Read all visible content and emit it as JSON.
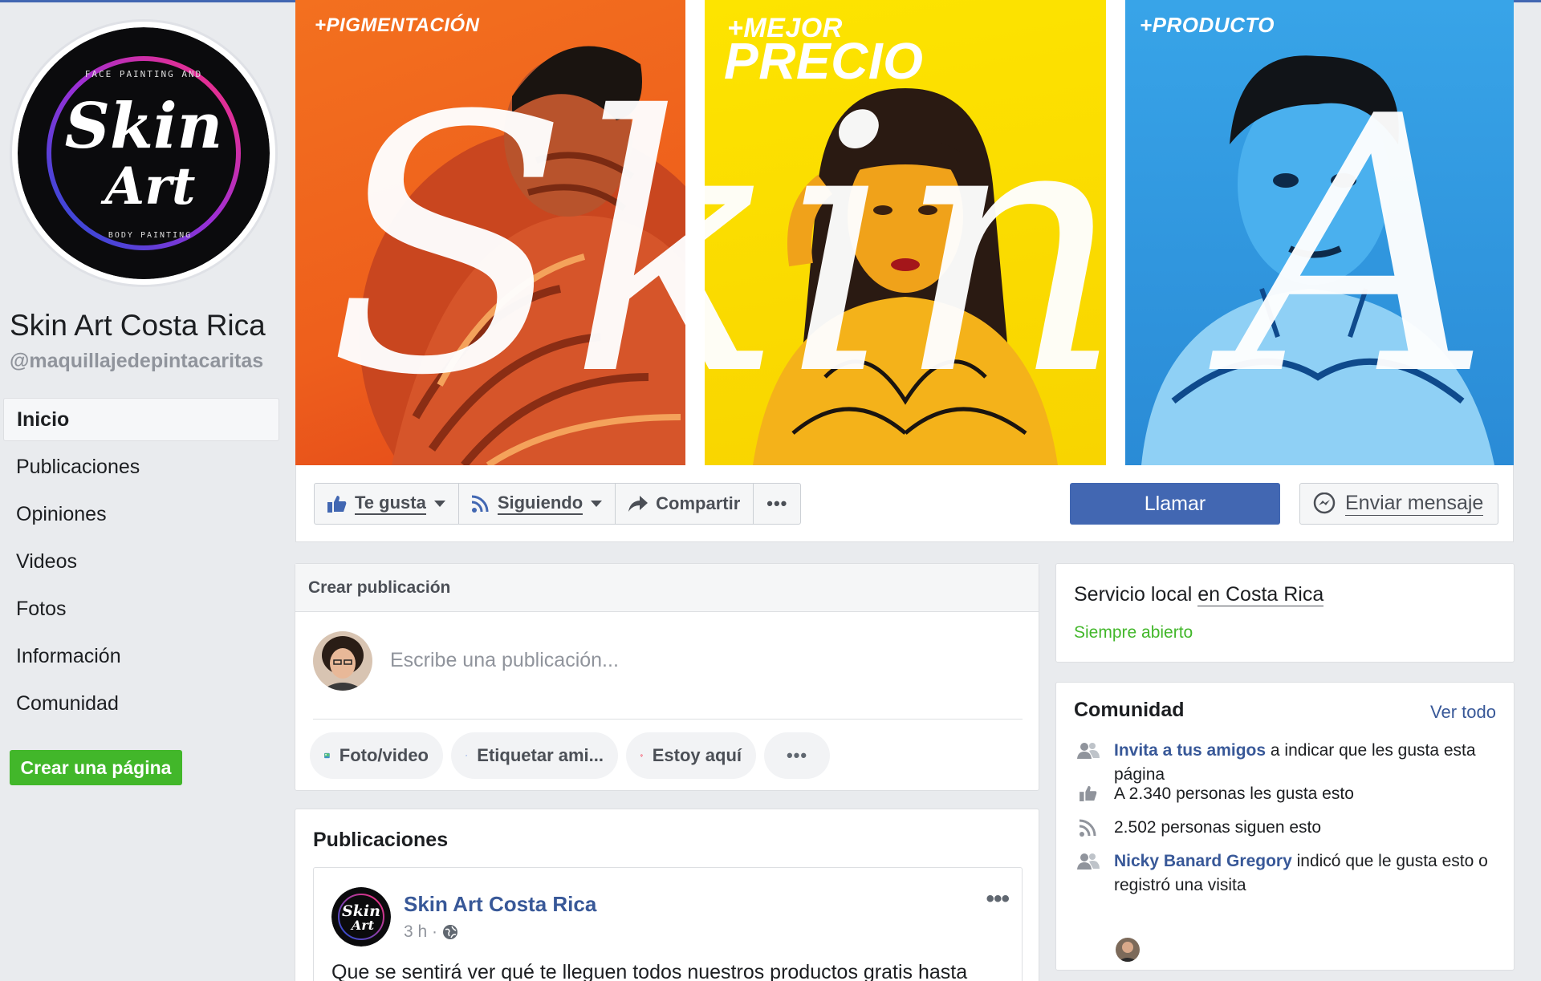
{
  "page": {
    "name": "Skin Art Costa Rica",
    "handle": "@maquillajedepintacaritas",
    "logo_text": {
      "line1": "Skin",
      "line2": "Art",
      "ring_top": "FACE PAINTING AND",
      "ring_bottom": "BODY PAINTING"
    }
  },
  "nav": {
    "items": [
      "Inicio",
      "Publicaciones",
      "Opiniones",
      "Videos",
      "Fotos",
      "Información",
      "Comunidad"
    ],
    "active_index": 0
  },
  "create_page_label": "Crear una página",
  "cover": {
    "captions": {
      "left": "+PIGMENTACIÓN",
      "middle_top": "+MEJOR",
      "middle_bottom": "PRECIO",
      "right": "+PRODUCTO"
    },
    "panel_colors": [
      "#f36b1d",
      "#fde400",
      "#33a0e6"
    ],
    "script_text": "Skin Art"
  },
  "actions": {
    "like": "Te gusta",
    "following": "Siguiendo",
    "share": "Compartir",
    "more": "•••",
    "call": "Llamar",
    "message": "Enviar mensaje"
  },
  "create_post": {
    "header": "Crear publicación",
    "placeholder": "Escribe una publicación...",
    "chips": [
      "Foto/video",
      "Etiquetar ami...",
      "Estoy aquí",
      "•••"
    ]
  },
  "posts": {
    "title": "Publicaciones",
    "first": {
      "author": "Skin Art Costa Rica",
      "time": "3 h ·",
      "more": "•••",
      "text": "Que se sentirá ver qué te lleguen todos nuestros productos gratis hasta"
    }
  },
  "info": {
    "category": "Servicio local",
    "location_prefix": "en",
    "location": "Costa Rica",
    "hours": "Siempre abierto"
  },
  "community": {
    "title": "Comunidad",
    "see_all": "Ver todo",
    "invite_link": "Invita a tus amigos",
    "invite_rest": "a indicar que les gusta esta página",
    "likes": "A 2.340 personas les gusta esto",
    "follows": "2.502 personas siguen esto",
    "friend_name": "Nicky Banard Gregory",
    "friend_rest": "indicó que le gusta esto o registró una visita"
  },
  "colors": {
    "brand_blue": "#4267b2",
    "link_blue": "#385898",
    "green": "#42b72a",
    "bg": "#e9ebee"
  }
}
